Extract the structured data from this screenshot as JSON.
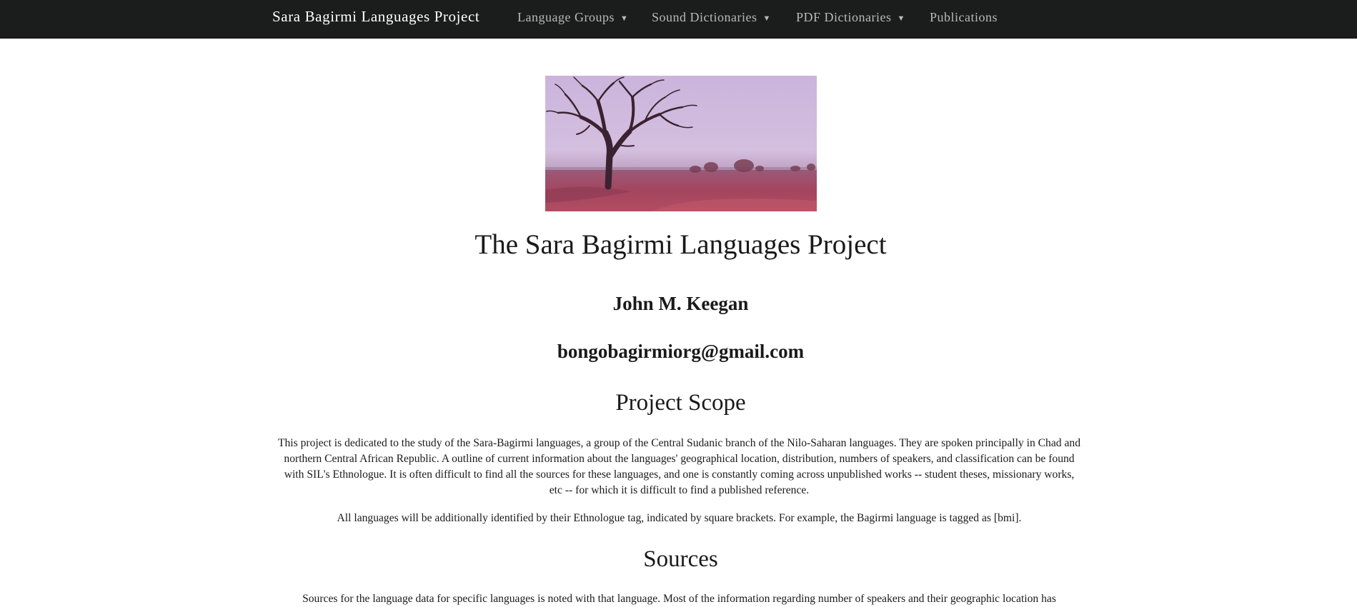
{
  "navbar": {
    "brand": "Sara Bagirmi Languages Project",
    "items": [
      {
        "label": "Language Groups",
        "dropdown": true
      },
      {
        "label": "Sound Dictionaries",
        "dropdown": true
      },
      {
        "label": "PDF Dictionaries",
        "dropdown": true
      },
      {
        "label": "Publications",
        "dropdown": false
      }
    ],
    "caret": "▼"
  },
  "colors": {
    "navbar_bg": "#1b1c1c",
    "brand_text": "#ffffff",
    "nav_text": "#b9b9b9",
    "body_text": "#1a1a1a"
  },
  "banner": {
    "subject": "photograph of a baobab tree in a savanna landscape"
  },
  "main": {
    "title": "The Sara Bagirmi Languages Project",
    "author": "John M. Keegan",
    "email": "bongobagirmiorg@gmail.com",
    "scope_heading": "Project Scope",
    "scope_paragraph_1": "This project is dedicated to the study of the Sara-Bagirmi languages, a group of the Central Sudanic branch of the Nilo-Saharan languages. They are spoken principally in Chad and northern Central African Republic. A outline of current information about the languages' geographical location, distribution, numbers of speakers, and classification can be found with SIL's Ethnologue. It is often difficult to find all the sources for these languages, and one is constantly coming across unpublished works -- student theses, missionary works, etc -- for which it is difficult to find a published reference.",
    "scope_paragraph_2": "All languages will be additionally identified by their Ethnologue tag, indicated by square brackets. For example, the Bagirmi language is tagged as [bmi].",
    "sources_heading": "Sources",
    "sources_paragraph": "Sources for the language data for specific languages is noted with that language. Most of the information regarding number of speakers and their geographic location has"
  }
}
